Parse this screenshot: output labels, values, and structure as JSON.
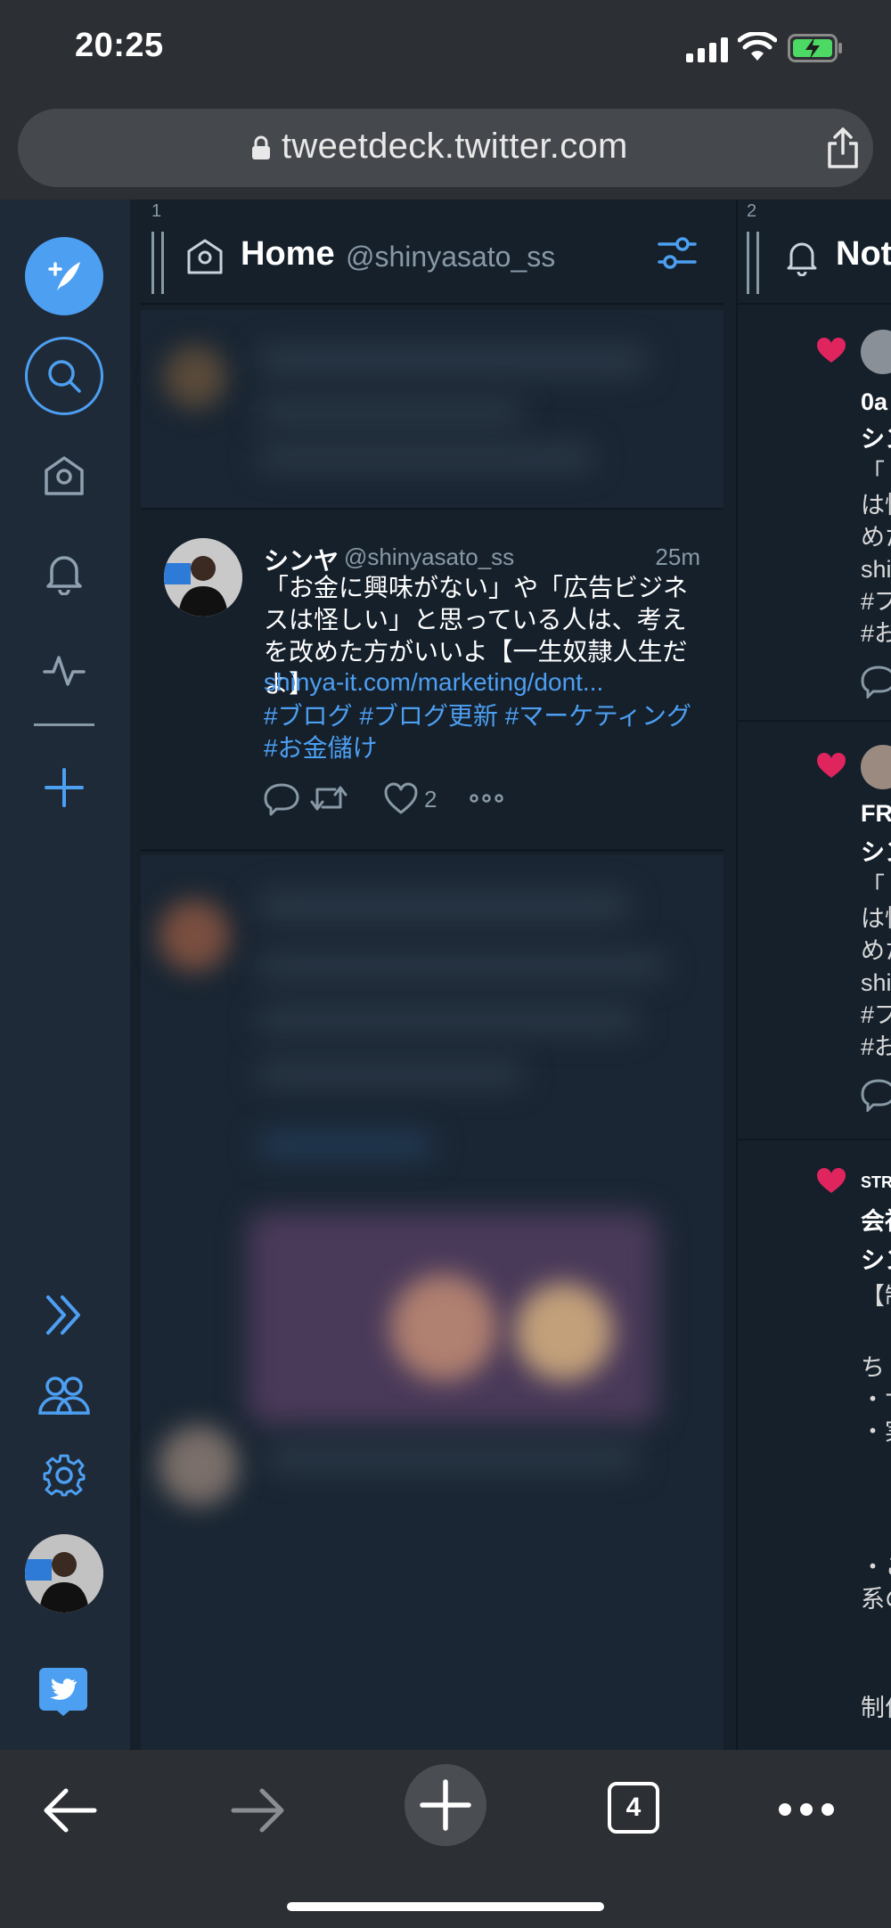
{
  "status_bar": {
    "time": "20:25"
  },
  "browser": {
    "url": "tweetdeck.twitter.com",
    "tab_count": "4"
  },
  "nav": {
    "items": [
      "compose-tweet",
      "search",
      "home",
      "notifications",
      "activity",
      "add-column",
      "expand",
      "accounts",
      "settings",
      "profile",
      "twitter"
    ]
  },
  "columns": [
    {
      "number": "1",
      "title": "Home",
      "subtitle": "@shinyasato_ss",
      "tweet": {
        "name": "シンヤ",
        "handle": "@shinyasato_ss",
        "time": "25m",
        "text": "「お金に興味がない」や「広告ビジネスは怪しい」と思っている人は、考えを改めた方がいいよ【一生奴隷人生だよ】",
        "link": "shinya-it.com/marketing/dont...",
        "hashtags": "#ブログ #ブログ更新 #マーケティング #お金儲け",
        "likes": "2"
      }
    },
    {
      "number": "2",
      "title": "Not",
      "cards": [
        {
          "lines": [
            "0a",
            "シン",
            "「",
            "は怪",
            "めた",
            "shi",
            "#ブ",
            "#お"
          ]
        },
        {
          "lines": [
            "FR",
            "シン",
            "「",
            "は怪",
            "めた",
            "shi",
            "#ブ",
            "#お"
          ]
        },
        {
          "lines": [
            "STR",
            "会社",
            "シン",
            "【制",
            "ち",
            "・サ",
            "・実",
            "・こ",
            "系の",
            "制作"
          ]
        }
      ]
    }
  ],
  "colors": {
    "accent": "#4d9ff2",
    "like": "#e0245e",
    "background": "#15202b"
  }
}
